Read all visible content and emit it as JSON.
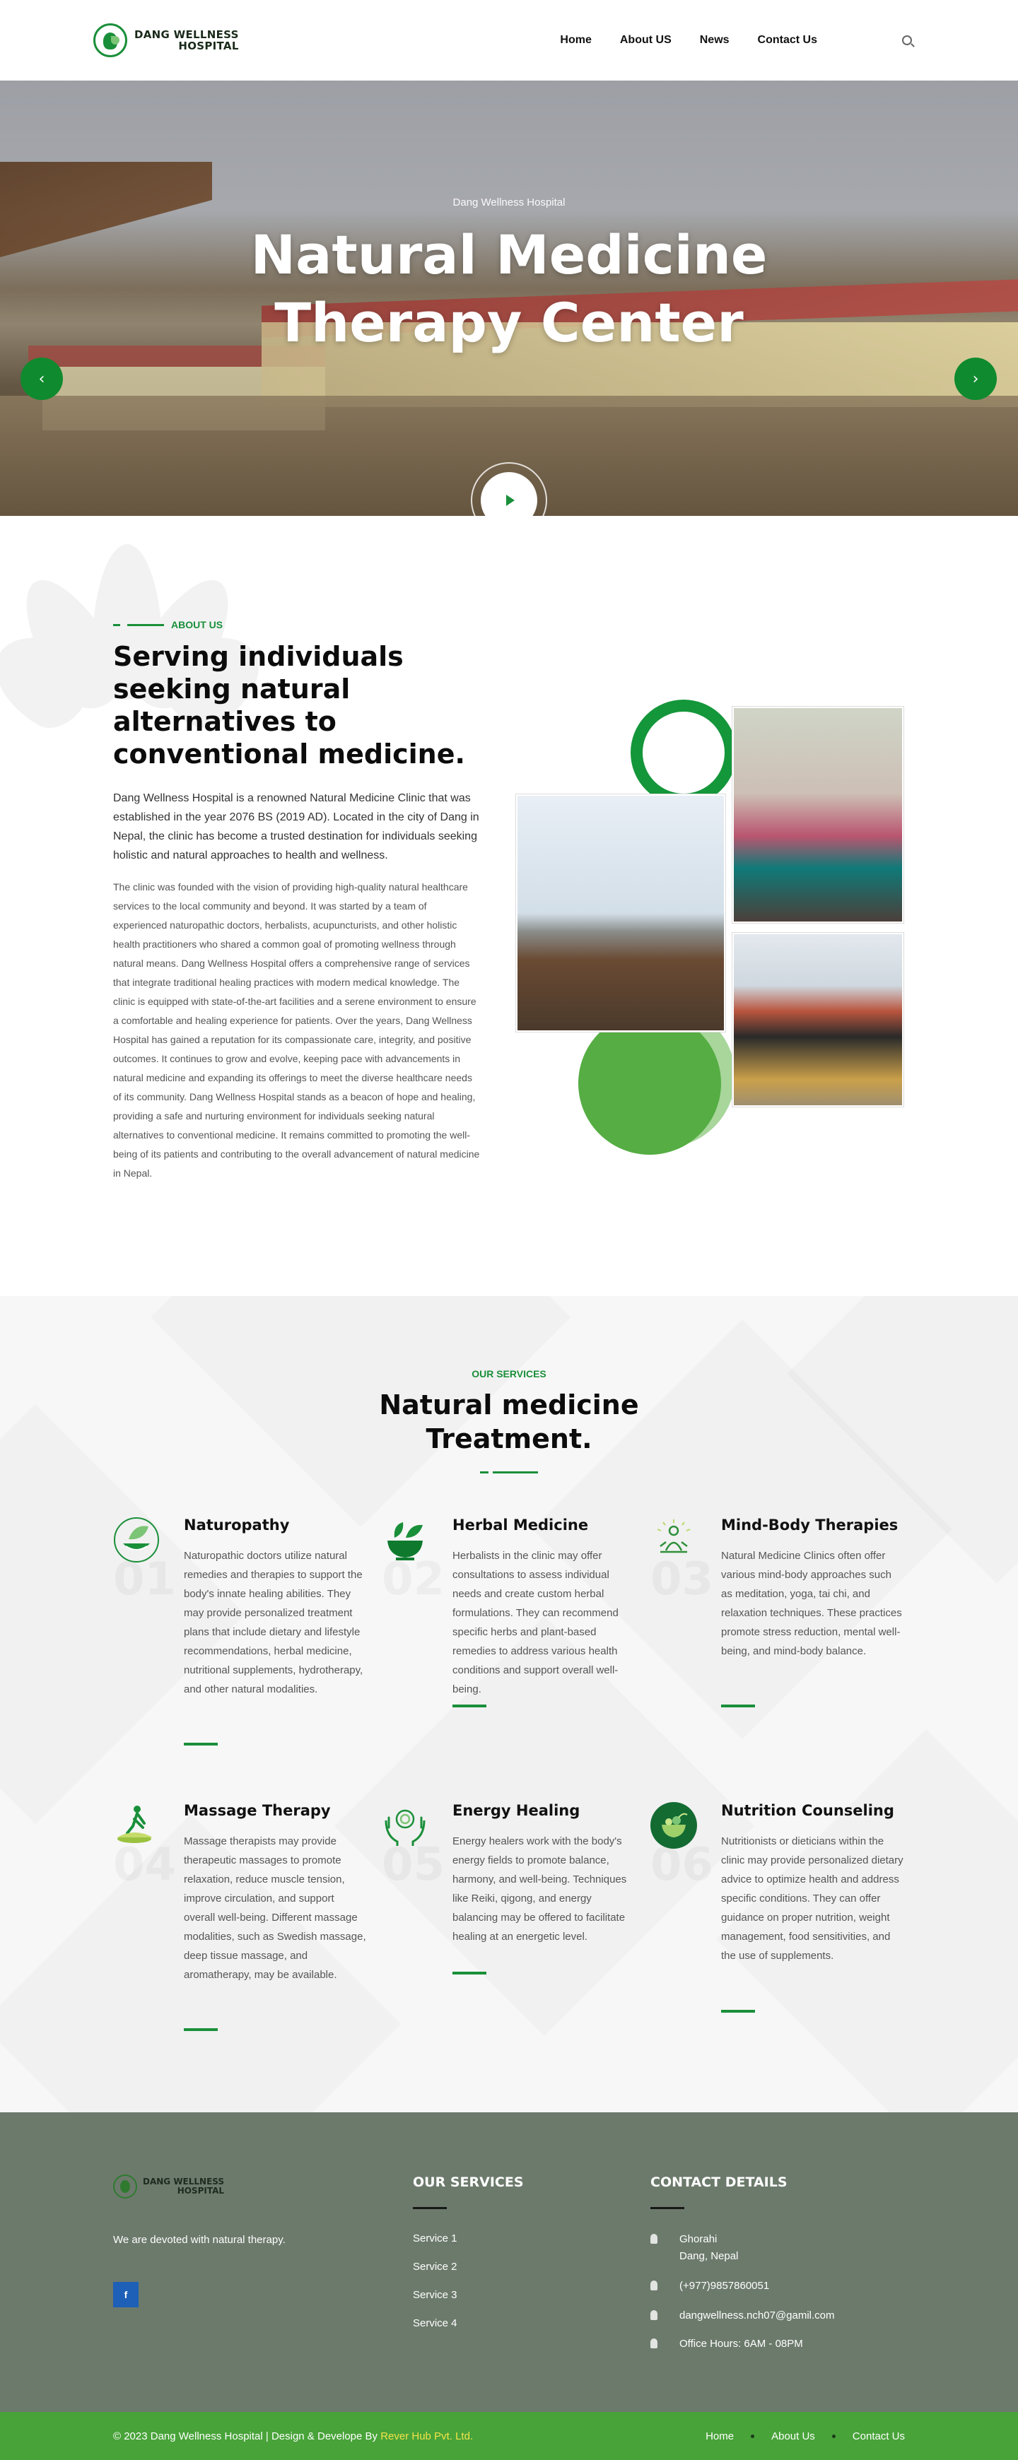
{
  "header": {
    "logo_line1": "DANG WELLNESS",
    "logo_line2": "HOSPITAL",
    "nav": [
      "Home",
      "About US",
      "News",
      "Contact Us"
    ]
  },
  "hero": {
    "subtitle": "Dang Wellness Hospital",
    "title_line1": "Natural Medicine",
    "title_line2": "Therapy Center"
  },
  "about": {
    "eyebrow": "ABOUT US",
    "title": "Serving individuals seeking natural alternatives to conventional medicine.",
    "lead": "Dang Wellness Hospital is a renowned Natural Medicine Clinic that was established in the year 2076 BS (2019 AD). Located in the city of Dang in Nepal, the clinic has become a trusted destination for individuals seeking holistic and natural approaches to health and wellness.",
    "body": "The clinic was founded with the vision of providing high-quality natural healthcare services to the local community and beyond. It was started by a team of experienced naturopathic doctors, herbalists, acupuncturists, and other holistic health practitioners who shared a common goal of promoting wellness through natural means. Dang Wellness Hospital offers a comprehensive range of services that integrate traditional healing practices with modern medical knowledge. The clinic is equipped with state-of-the-art facilities and a serene environment to ensure a comfortable and healing experience for patients. Over the years, Dang Wellness Hospital has gained a reputation for its compassionate care, integrity, and positive outcomes. It continues to grow and evolve, keeping pace with advancements in natural medicine and expanding its offerings to meet the diverse healthcare needs of its community. Dang Wellness Hospital stands as a beacon of hope and healing, providing a safe and nurturing environment for individuals seeking natural alternatives to conventional medicine. It remains committed to promoting the well-being of its patients and contributing to the overall advancement of natural medicine in Nepal."
  },
  "services": {
    "eyebrow": "OUR SERVICES",
    "title_line1": "Natural medicine",
    "title_line2": "Treatment.",
    "items": [
      {
        "num": "01",
        "icon": "leaf-bowl-icon",
        "title": "Naturopathy",
        "text": "Naturopathic doctors utilize natural remedies and therapies to support the body's innate healing abilities. They may provide personalized treatment plans that include dietary and lifestyle recommendations, herbal medicine, nutritional supplements, hydrotherapy, and other natural modalities."
      },
      {
        "num": "02",
        "icon": "herbal-mortar-icon",
        "title": "Herbal Medicine",
        "text": "Herbalists in the clinic may offer consultations to assess individual needs and create custom herbal formulations. They can recommend specific herbs and plant-based remedies to address various health conditions and support overall well-being."
      },
      {
        "num": "03",
        "icon": "meditation-icon",
        "title": "Mind-Body Therapies",
        "text": "Natural Medicine Clinics often offer various mind-body approaches such as meditation, yoga, tai chi, and relaxation techniques. These practices promote stress reduction, mental well-being, and mind-body balance."
      },
      {
        "num": "04",
        "icon": "massage-icon",
        "title": "Massage Therapy",
        "text": "Massage therapists may provide therapeutic massages to promote relaxation, reduce muscle tension, improve circulation, and support overall well-being. Different massage modalities, such as Swedish massage, deep tissue massage, and aromatherapy, may be available."
      },
      {
        "num": "05",
        "icon": "energy-hands-icon",
        "title": "Energy Healing",
        "text": "Energy healers work with the body's energy fields to promote balance, harmony, and well-being. Techniques like Reiki, qigong, and energy balancing may be offered to facilitate healing at an energetic level."
      },
      {
        "num": "06",
        "icon": "nutrition-bowl-icon",
        "title": "Nutrition Counseling",
        "text": "Nutritionists or dieticians within the clinic may provide personalized dietary advice to optimize health and address specific conditions. They can offer guidance on proper nutrition, weight management, food sensitivities, and the use of supplements."
      }
    ]
  },
  "footer": {
    "logo_line1": "DANG WELLNESS",
    "logo_line2": "HOSPITAL",
    "tagline": "We are devoted with natural therapy.",
    "facebook": "f",
    "services_title": "OUR SERVICES",
    "service_links": [
      "Service 1",
      "Service 2",
      "Service 3",
      "Service 4"
    ],
    "contact_title": "CONTACT DETAILS",
    "address_line1": "Ghorahi",
    "address_line2": "Dang, Nepal",
    "phone": "(+977)9857860051",
    "email": "dangwellness.nch07@gamil.com",
    "hours": "Office Hours: 6AM - 08PM"
  },
  "bottom": {
    "copyright": "© 2023 Dang Wellness Hospital | Design & Develope By ",
    "credit": "Rever Hub Pvt. Ltd.",
    "nav": [
      "Home",
      "About Us",
      "Contact Us"
    ]
  },
  "colors": {
    "brand_green": "#1a8f3a",
    "footer_bg": "#6c7a6c",
    "bottom_bar": "#48a339",
    "credit_yellow": "#f3e34a"
  }
}
